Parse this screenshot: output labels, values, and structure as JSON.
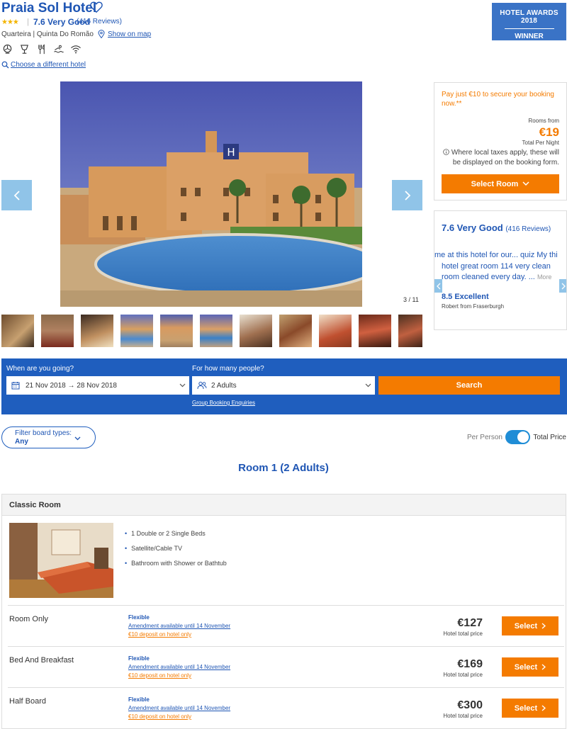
{
  "hotel": {
    "name": "Praia Sol Hotel",
    "stars": "★★★",
    "rating_text": "7.6 Very Good",
    "reviews_count": "(416 Reviews)",
    "location": "Quarteira | Quinta Do Romão",
    "show_on_map": "Show on map",
    "choose_different": "Choose a different hotel",
    "amenities": [
      "aircon-icon",
      "bar-icon",
      "restaurant-icon",
      "pool-icon",
      "wifi-icon"
    ]
  },
  "award": {
    "line1": "HOTEL AWARDS 2018",
    "line2": "WINNER"
  },
  "gallery": {
    "counter": "3 / 11",
    "thumb_count": 11
  },
  "booking": {
    "pay_text": "Pay just €10 to secure your booking now.**",
    "rooms_from": "Rooms from",
    "price": "€19",
    "total_per_night": "Total Per Night",
    "tax_note": "Where local taxes apply, these will be displayed on the booking form.",
    "select_room": "Select Room"
  },
  "review": {
    "score_text": "7.6 Very Good",
    "count": "(416 Reviews)",
    "snippet_prev": "me at this hotel for our... quiz My thi",
    "body": "hotel great room 114 very clean room cleaned every day. ...",
    "more": "More",
    "score2": "8.5 Excellent",
    "author": "Robert from Fraserburgh"
  },
  "search": {
    "when_label": "When are you going?",
    "dates": "21 Nov 2018 → 28 Nov 2018",
    "people_label": "For how many people?",
    "people_value": "2 Adults",
    "search_button": "Search",
    "group_link": "Group Booking Enquiries"
  },
  "filter": {
    "label": "Filter board types:",
    "value": "Any",
    "toggle_left": "Per Person",
    "toggle_right": "Total Price"
  },
  "room": {
    "heading": "Room 1 (2 Adults)",
    "type": "Classic Room",
    "features": [
      "1 Double or 2 Single Beds",
      "Satellite/Cable TV",
      "Bathroom with Shower or Bathtub"
    ],
    "rates": [
      {
        "name": "Room Only",
        "flex": "Flexible",
        "amend": "Amendment available until 14 November",
        "deposit": "€10 deposit on hotel only",
        "price": "€127",
        "price_label": "Hotel total price",
        "button": "Select"
      },
      {
        "name": "Bed And Breakfast",
        "flex": "Flexible",
        "amend": "Amendment available until 14 November",
        "deposit": "€10 deposit on hotel only",
        "price": "€169",
        "price_label": "Hotel total price",
        "button": "Select"
      },
      {
        "name": "Half Board",
        "flex": "Flexible",
        "amend": "Amendment available until 14 November",
        "deposit": "€10 deposit on hotel only",
        "price": "€300",
        "price_label": "Hotel total price",
        "button": "Select"
      }
    ]
  },
  "colors": {
    "brand_blue": "#1f56b4",
    "orange": "#f47b00",
    "search_bg": "#1f5ebe",
    "arrow_bg": "#90c4e8"
  }
}
